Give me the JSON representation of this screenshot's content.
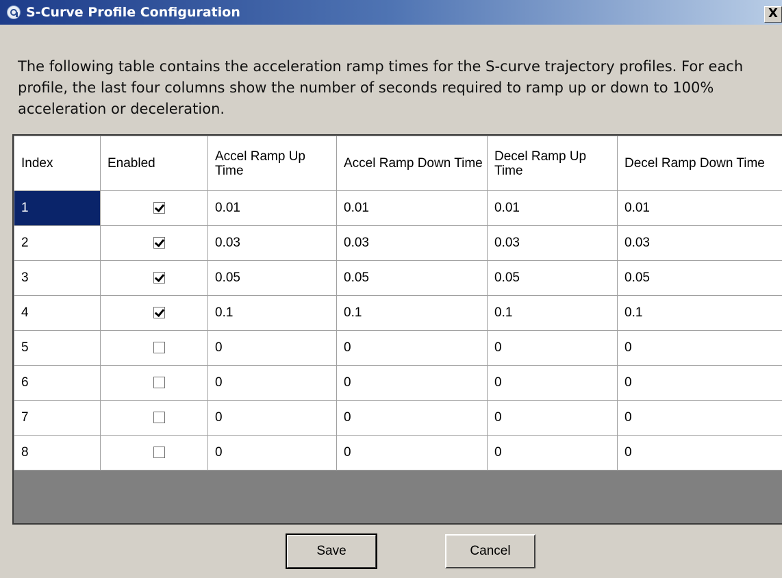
{
  "window": {
    "title": "S-Curve Profile Configuration",
    "close_label": "X",
    "icon": "app-logo-icon"
  },
  "description": "The following table contains the acceleration ramp times for the S-curve trajectory profiles. For each profile, the last four columns show the number of seconds required to ramp up or down to 100% acceleration or deceleration.",
  "table": {
    "headers": [
      "Index",
      "Enabled",
      "Accel Ramp Up Time",
      "Accel Ramp Down Time",
      "Decel Ramp Up Time",
      "Decel Ramp Down Time"
    ],
    "rows": [
      {
        "index": "1",
        "enabled": true,
        "accel_up": "0.01",
        "accel_down": "0.01",
        "decel_up": "0.01",
        "decel_down": "0.01",
        "selected": true
      },
      {
        "index": "2",
        "enabled": true,
        "accel_up": "0.03",
        "accel_down": "0.03",
        "decel_up": "0.03",
        "decel_down": "0.03"
      },
      {
        "index": "3",
        "enabled": true,
        "accel_up": "0.05",
        "accel_down": "0.05",
        "decel_up": "0.05",
        "decel_down": "0.05"
      },
      {
        "index": "4",
        "enabled": true,
        "accel_up": "0.1",
        "accel_down": "0.1",
        "decel_up": "0.1",
        "decel_down": "0.1"
      },
      {
        "index": "5",
        "enabled": false,
        "accel_up": "0",
        "accel_down": "0",
        "decel_up": "0",
        "decel_down": "0"
      },
      {
        "index": "6",
        "enabled": false,
        "accel_up": "0",
        "accel_down": "0",
        "decel_up": "0",
        "decel_down": "0"
      },
      {
        "index": "7",
        "enabled": false,
        "accel_up": "0",
        "accel_down": "0",
        "decel_up": "0",
        "decel_down": "0"
      },
      {
        "index": "8",
        "enabled": false,
        "accel_up": "0",
        "accel_down": "0",
        "decel_up": "0",
        "decel_down": "0"
      }
    ]
  },
  "buttons": {
    "save_label": "Save",
    "cancel_label": "Cancel"
  },
  "colors": {
    "titlebar_start": "#1d3c8a",
    "titlebar_end": "#b9cde6",
    "selection": "#0a246a",
    "dialog_bg": "#d4d0c8",
    "grid_empty_bg": "#808080"
  }
}
